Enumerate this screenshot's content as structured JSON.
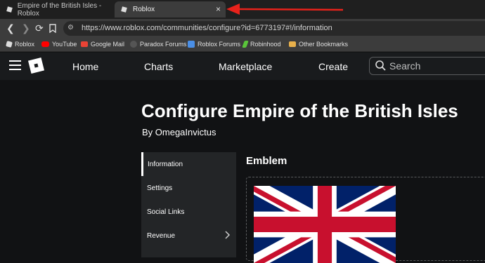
{
  "browser": {
    "tabs": [
      {
        "title": "Empire of the British Isles - Roblox",
        "active": false
      },
      {
        "title": "Roblox",
        "active": true
      }
    ],
    "tab_close": "×",
    "url": "https://www.roblox.com/communities/configure?id=6773197#!/information",
    "bookmarks": [
      {
        "label": "Roblox",
        "icon": "roblox-icon",
        "color": "#dddddd"
      },
      {
        "label": "YouTube",
        "icon": "youtube-icon",
        "color": "#ff0000"
      },
      {
        "label": "Google Mail",
        "icon": "gmail-icon",
        "color": "#ea4335"
      },
      {
        "label": "Paradox Forums",
        "icon": "paradox-icon",
        "color": "#555555"
      },
      {
        "label": "Roblox Forums",
        "icon": "roblox-forums-icon",
        "color": "#4a8fe7"
      },
      {
        "label": "Robinhood",
        "icon": "robinhood-icon",
        "color": "#5ac53a"
      },
      {
        "label": "Other Bookmarks",
        "icon": "folder-icon",
        "color": "#e8b04b"
      }
    ]
  },
  "nav": {
    "links": [
      "Home",
      "Charts",
      "Marketplace",
      "Create"
    ],
    "search_placeholder": "Search"
  },
  "page": {
    "title": "Configure Empire of the British Isles",
    "byline": "By OmegaInvictus",
    "sidebar": [
      {
        "label": "Information",
        "active": true
      },
      {
        "label": "Settings"
      },
      {
        "label": "Social Links"
      },
      {
        "label": "Revenue",
        "has_chevron": true
      }
    ],
    "emblem_heading": "Emblem"
  },
  "colors": {
    "annotation_arrow": "#e8221b",
    "flag_blue": "#012169",
    "flag_red": "#c8102e"
  }
}
